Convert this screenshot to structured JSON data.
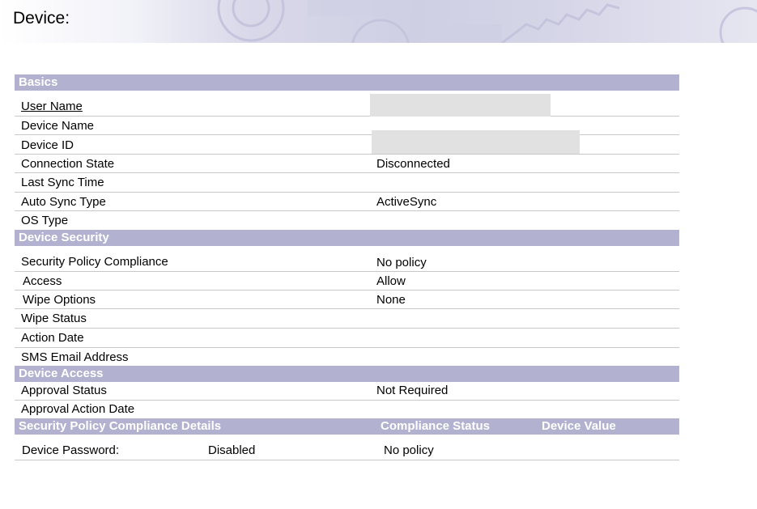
{
  "header": {
    "title": "Device:"
  },
  "sections": {
    "basics": "Basics",
    "device_security": "Device Security",
    "device_access": "Device Access",
    "compliance": {
      "title": "Security Policy Compliance Details",
      "col_status": "Compliance Status",
      "col_value": "Device Value"
    }
  },
  "basics": {
    "user_name": {
      "label": "User Name",
      "value": ""
    },
    "device_name": {
      "label": "Device Name",
      "value": ""
    },
    "device_id": {
      "label": "Device ID",
      "value": ""
    },
    "connection_state": {
      "label": "Connection State",
      "value": "Disconnected"
    },
    "last_sync_time": {
      "label": "Last Sync Time",
      "value": ""
    },
    "auto_sync_type": {
      "label": "Auto Sync Type",
      "value": "ActiveSync"
    },
    "os_type": {
      "label": "OS Type",
      "value": ""
    }
  },
  "security": {
    "policy_compliance": {
      "label": "Security Policy Compliance",
      "value": "No policy"
    },
    "access": {
      "label": "Access",
      "value": "Allow"
    },
    "wipe_options": {
      "label": "Wipe Options",
      "value": "None"
    },
    "wipe_status": {
      "label": "Wipe Status",
      "value": ""
    },
    "action_date": {
      "label": "Action Date",
      "value": ""
    },
    "sms_email": {
      "label": "SMS Email Address",
      "value": ""
    }
  },
  "access": {
    "approval_status": {
      "label": "Approval Status",
      "value": "Not Required"
    },
    "approval_action_date": {
      "label": "Approval Action Date",
      "value": ""
    }
  },
  "compliance_rows": [
    {
      "label": "Device Password:",
      "setting": "Disabled",
      "status": "No policy",
      "device_value": ""
    }
  ]
}
